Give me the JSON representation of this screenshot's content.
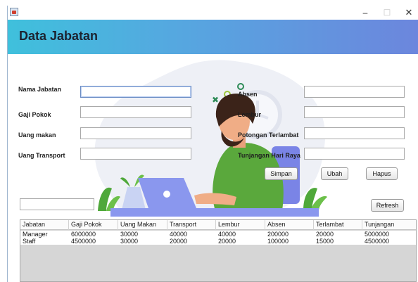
{
  "window": {
    "title": ""
  },
  "header": {
    "title": "Data Jabatan"
  },
  "form_left": {
    "nama_jabatan": {
      "label": "Nama Jabatan",
      "value": ""
    },
    "gaji_pokok": {
      "label": "Gaji Pokok",
      "value": ""
    },
    "uang_makan": {
      "label": "Uang makan",
      "value": ""
    },
    "uang_transport": {
      "label": "Uang Transport",
      "value": ""
    }
  },
  "form_right": {
    "absen": {
      "label": "Absen",
      "value": ""
    },
    "lembur": {
      "label": "Lembur",
      "value": ""
    },
    "potongan_terlambat": {
      "label": "Potongan Terlambat",
      "value": ""
    },
    "tunjangan_hari_raya": {
      "label": "Tunjangan Hari Raya",
      "value": ""
    }
  },
  "buttons": {
    "simpan": "Simpan",
    "ubah": "Ubah",
    "hapus": "Hapus",
    "refresh": "Refresh"
  },
  "search": {
    "value": ""
  },
  "table": {
    "columns": [
      "Jabatan",
      "Gaji Pokok",
      "Uang Makan",
      "Transport",
      "Lembur",
      "Absen",
      "Terlambat",
      "Tunjangan"
    ],
    "rows": [
      [
        "Manager",
        "6000000",
        "30000",
        "40000",
        "40000",
        "200000",
        "20000",
        "5000000"
      ],
      [
        "Staff",
        "4500000",
        "30000",
        "20000",
        "20000",
        "100000",
        "15000",
        "4500000"
      ]
    ]
  },
  "colors": {
    "header_gradient_start": "#3fc0dc",
    "header_gradient_end": "#6c86dd",
    "illustration_shirt": "#5aa83c",
    "illustration_laptop": "#8a97ee"
  },
  "icons": [
    "java-app-icon",
    "minimize-icon",
    "maximize-icon",
    "close-icon"
  ]
}
